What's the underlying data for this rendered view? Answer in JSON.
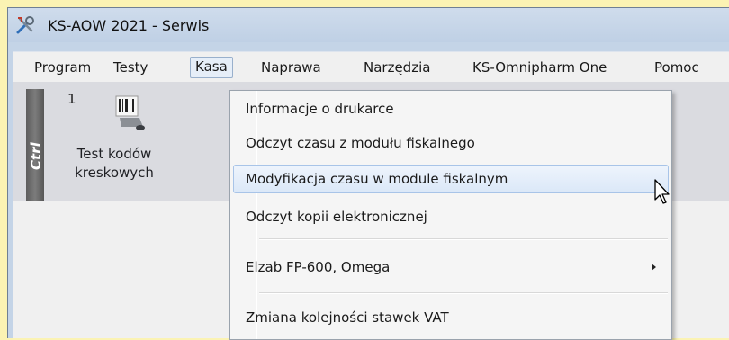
{
  "window": {
    "title": "KS-AOW 2021 - Serwis",
    "icon": "tools-icon"
  },
  "menubar": {
    "items": [
      {
        "label": "Program"
      },
      {
        "label": "Testy"
      },
      {
        "label": "Kasa"
      },
      {
        "label": "Naprawa"
      },
      {
        "label": "Narzędzia"
      },
      {
        "label": "KS-Omnipharm One"
      },
      {
        "label": "Pomoc"
      }
    ],
    "open_menu": "Kasa"
  },
  "toolbar": {
    "ctrl_label": "Ctrl",
    "tiles": [
      {
        "number": "1",
        "label_line1": "Test kodów",
        "label_line2": "kreskowych",
        "icon": "barcode-scanner-icon"
      }
    ]
  },
  "dropdown": {
    "items": [
      {
        "label": "Informacje o drukarce"
      },
      {
        "label": "Odczyt czasu z modułu fiskalnego"
      },
      {
        "label": "Modyfikacja czasu w module fiskalnym",
        "highlighted": true
      },
      {
        "label": "Odczyt kopii elektronicznej"
      },
      {
        "label": "Elzab FP-600, Omega",
        "has_submenu": true
      },
      {
        "label": "Zmiana kolejności stawek VAT"
      }
    ]
  },
  "colors": {
    "background": "#fbf3b3",
    "titlebar": "#c4d4e7",
    "menubar": "#f0f0f0",
    "highlight": "#dbe8f8"
  }
}
